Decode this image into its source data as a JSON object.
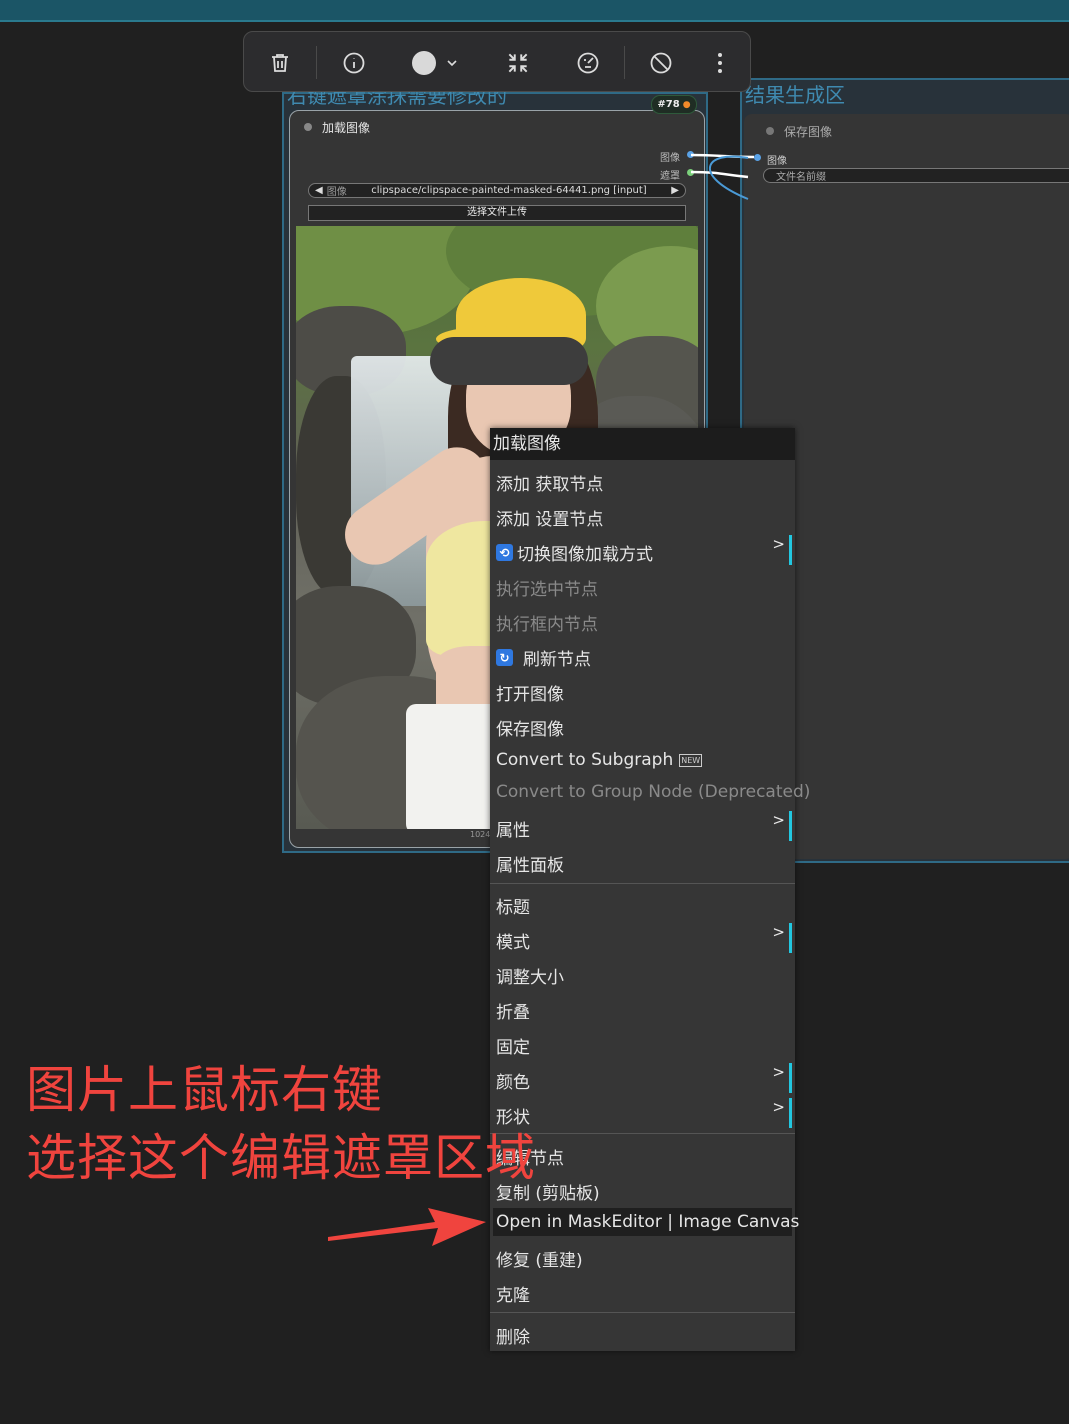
{
  "toolbar": {
    "buttons": [
      "trash-icon",
      "info-icon",
      "color-circle-icon",
      "collapse-icon",
      "bypass-icon",
      "disable-icon",
      "more-icon"
    ]
  },
  "groups": {
    "left_title": "右键遮罩涂抹需要修改的",
    "right_title": "结果生成区"
  },
  "load_node": {
    "badge": "#78",
    "title": "加载图像",
    "outputs": [
      "图像",
      "遮罩"
    ],
    "combo_label": "图像",
    "combo_value": "clipspace/clipspace-painted-masked-64441.png [input]",
    "upload_label": "选择文件上传",
    "image_size": "1024"
  },
  "save_node": {
    "title": "保存图像",
    "input_label": "图像",
    "prefix_label": "文件名前缀"
  },
  "context_menu": {
    "title": "加载图像",
    "items": [
      {
        "label": "添加 获取节点"
      },
      {
        "label": "添加 设置节点"
      },
      {
        "label": "切换图像加载方式"
      },
      {
        "label": "执行选中节点"
      },
      {
        "label": "执行框内节点"
      },
      {
        "label": "刷新节点"
      },
      {
        "label": "打开图像"
      },
      {
        "label": "保存图像"
      },
      {
        "label": "Convert to Subgraph",
        "badge": "NEW"
      },
      {
        "label": "Convert to Group Node (Deprecated)"
      },
      {
        "label": "属性"
      },
      {
        "label": "属性面板"
      },
      {
        "label": "标题"
      },
      {
        "label": "模式"
      },
      {
        "label": "调整大小"
      },
      {
        "label": "折叠"
      },
      {
        "label": "固定"
      },
      {
        "label": "颜色"
      },
      {
        "label": "形状"
      },
      {
        "label": "编辑节点"
      },
      {
        "label": "复制 (剪贴板)"
      },
      {
        "label": "Open in MaskEditor | Image Canvas"
      },
      {
        "label": "修复 (重建)"
      },
      {
        "label": "克隆"
      },
      {
        "label": "删除"
      }
    ],
    "submenu_arrow": ">"
  },
  "annotation": {
    "line1": "图片上鼠标右键",
    "line2": "选择这个编辑遮罩区域"
  },
  "colors": {
    "accent": "#22c7e0",
    "annotation": "#f0443e",
    "group_border": "#2f6a86"
  }
}
